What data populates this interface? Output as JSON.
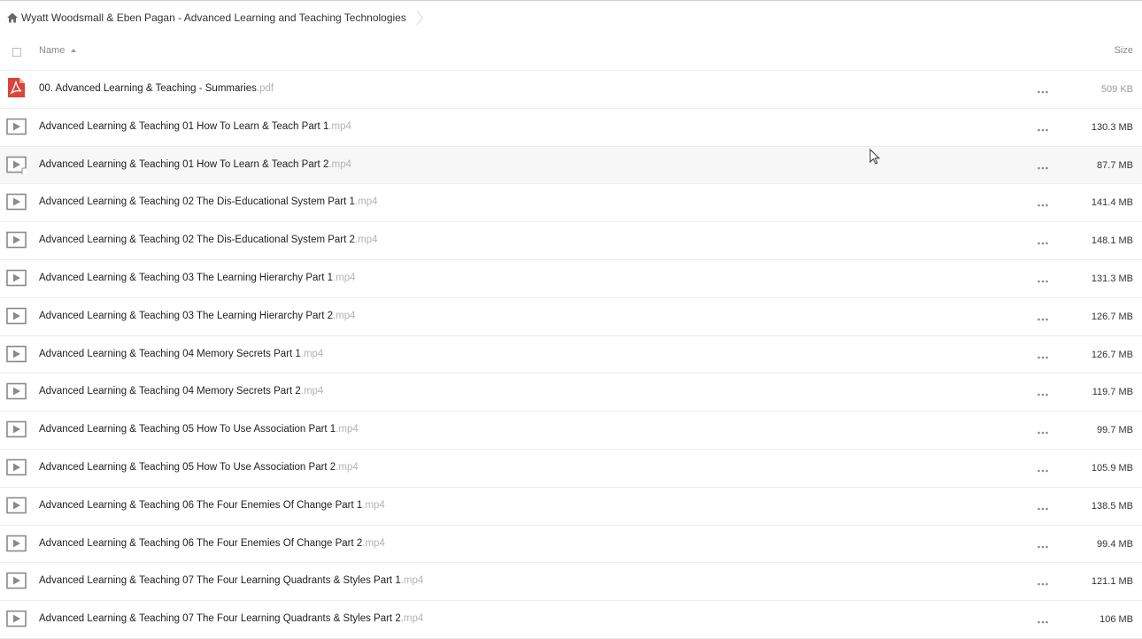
{
  "breadcrumb": {
    "home_icon": "home-icon",
    "folder_title": "Wyatt Woodsmall & Eben Pagan - Advanced Learning and Teaching Technologies"
  },
  "header": {
    "name_label": "Name",
    "size_label": "Size",
    "sort": "ascending"
  },
  "files": [
    {
      "name": "00. Advanced Learning & Teaching - Summaries",
      "ext": ".pdf",
      "size": "509 KB",
      "type": "pdf"
    },
    {
      "name": "Advanced Learning & Teaching 01 How To Learn & Teach Part 1",
      "ext": ".mp4",
      "size": "130.3 MB",
      "type": "video"
    },
    {
      "name": "Advanced Learning & Teaching 01 How To Learn & Teach Part 2",
      "ext": ".mp4",
      "size": "87.7 MB",
      "type": "video"
    },
    {
      "name": "Advanced Learning & Teaching 02 The Dis-Educational System Part 1",
      "ext": ".mp4",
      "size": "141.4 MB",
      "type": "video"
    },
    {
      "name": "Advanced Learning & Teaching 02 The Dis-Educational System Part 2",
      "ext": ".mp4",
      "size": "148.1 MB",
      "type": "video"
    },
    {
      "name": "Advanced Learning & Teaching 03 The Learning Hierarchy Part 1",
      "ext": ".mp4",
      "size": "131.3 MB",
      "type": "video"
    },
    {
      "name": "Advanced Learning & Teaching 03 The Learning Hierarchy Part 2",
      "ext": ".mp4",
      "size": "126.7 MB",
      "type": "video"
    },
    {
      "name": "Advanced Learning & Teaching 04 Memory Secrets Part 1",
      "ext": ".mp4",
      "size": "126.7 MB",
      "type": "video"
    },
    {
      "name": "Advanced Learning & Teaching 04 Memory Secrets Part 2",
      "ext": ".mp4",
      "size": "119.7 MB",
      "type": "video"
    },
    {
      "name": "Advanced Learning & Teaching 05 How To Use Association Part 1",
      "ext": ".mp4",
      "size": "99.7 MB",
      "type": "video"
    },
    {
      "name": "Advanced Learning & Teaching 05 How To Use Association Part 2",
      "ext": ".mp4",
      "size": "105.9 MB",
      "type": "video"
    },
    {
      "name": "Advanced Learning & Teaching 06 The Four Enemies Of Change Part 1",
      "ext": ".mp4",
      "size": "138.5 MB",
      "type": "video"
    },
    {
      "name": "Advanced Learning & Teaching 06 The Four Enemies Of Change Part 2",
      "ext": ".mp4",
      "size": "99.4 MB",
      "type": "video"
    },
    {
      "name": "Advanced Learning & Teaching 07 The Four Learning Quadrants & Styles Part 1",
      "ext": ".mp4",
      "size": "121.1 MB",
      "type": "video"
    },
    {
      "name": "Advanced Learning & Teaching 07 The Four Learning Quadrants & Styles Part 2",
      "ext": ".mp4",
      "size": "106 MB",
      "type": "video"
    }
  ],
  "colors": {
    "pdf_red": "#d9453a",
    "icon_gray": "#8a8a8a",
    "ext_gray": "#b3b3b3"
  },
  "icons": {
    "pdf": "pdf-file-icon",
    "video": "video-file-icon",
    "more": "more-options-icon"
  }
}
